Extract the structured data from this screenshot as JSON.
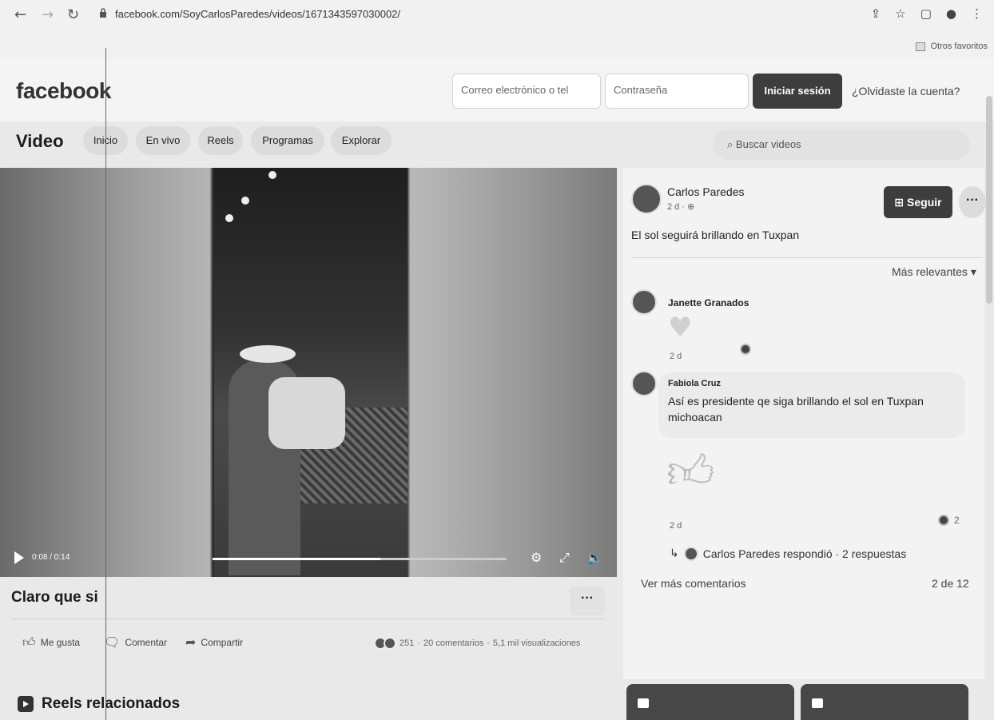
{
  "browser": {
    "url": "facebook.com/SoyCarlosParedes/videos/1671343597030002/",
    "bookmark": "Otros favoritos",
    "icons": [
      "share-icon",
      "star-icon",
      "sidebar-icon",
      "profile-icon",
      "menu-icon"
    ]
  },
  "header": {
    "logo": "facebook",
    "email_placeholder": "Correo electrónico o tel",
    "password_placeholder": "Contraseña",
    "login_label": "Iniciar sesión",
    "forgot_label": "¿Olvidaste la cuenta?"
  },
  "video_nav": {
    "title": "Video",
    "tabs": [
      "Inicio",
      "En vivo",
      "Reels",
      "Programas",
      "Explorar"
    ],
    "search_placeholder": "Buscar videos"
  },
  "player": {
    "time": "0:08 / 0:14",
    "progress": 0.57
  },
  "post": {
    "title": "Claro que si",
    "actions": {
      "like": "Me gusta",
      "comment": "Comentar",
      "share": "Compartir"
    },
    "reactions": "251",
    "comments": "20 comentarios",
    "views": "5,1 mil visualizaciones"
  },
  "reels": {
    "title": "Reels relacionados"
  },
  "side": {
    "author": "Carlos Paredes",
    "meta": "2 d ·",
    "caption": "El sol  seguirá brillando en Tuxpan",
    "follow_label": "Seguir",
    "sort_label": "Más relevantes",
    "comments": [
      {
        "name": "Janette Granados",
        "time": "2 d"
      },
      {
        "name": "Fabiola Cruz",
        "text": "Así es presidente qe siga brillando el sol en Tuxpan michoacan",
        "time": "2 d",
        "likes": "2"
      }
    ],
    "reply_text": "Carlos Paredes respondió · 2 respuestas",
    "more_comments": "Ver más comentarios",
    "count": "2 de 12"
  }
}
